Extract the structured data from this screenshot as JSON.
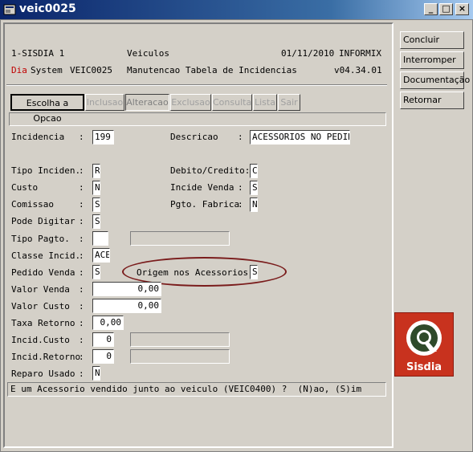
{
  "window": {
    "title": "veic0025",
    "minimize_glyph": "_",
    "maximize_glyph": "□",
    "close_glyph": "×"
  },
  "header": {
    "line1": {
      "system": "1-SISDIA 1",
      "module": "Veiculos",
      "date": "01/11/2010",
      "db": "INFORMIX"
    },
    "line2": {
      "prefix": "Dia",
      "system": "System",
      "program": "VEIC0025",
      "description": "Manutencao Tabela de Incidencias",
      "version": "v04.34.01"
    }
  },
  "menu": {
    "items": [
      {
        "label": "Escolha a Opcao",
        "state": "active"
      },
      {
        "label": "Inclusao",
        "state": "disabled"
      },
      {
        "label": "Alteracao",
        "state": "pressed"
      },
      {
        "label": "Exclusao",
        "state": "disabled"
      },
      {
        "label": "Consulta",
        "state": "disabled"
      },
      {
        "label": "Lista",
        "state": "disabled"
      },
      {
        "label": "Sair",
        "state": "disabled"
      }
    ]
  },
  "form": {
    "incidencia": {
      "label": "Incidencia",
      "value": "199"
    },
    "descricao": {
      "label": "Descricao",
      "value": "ACESSORIOS NO PEDIDO"
    },
    "tipo_inciden": {
      "label": "Tipo Inciden.",
      "value": "R"
    },
    "debito_credito": {
      "label": "Debito/Credito:",
      "value": "C"
    },
    "custo": {
      "label": "Custo",
      "value": "N"
    },
    "incide_venda": {
      "label": "Incide Venda",
      "value": "S"
    },
    "comissao": {
      "label": "Comissao",
      "value": "S"
    },
    "pgto_fabrica": {
      "label": "Pgto. Fabrica",
      "value": "N"
    },
    "pode_digitar": {
      "label": "Pode Digitar",
      "value": "S"
    },
    "tipo_pagto": {
      "label": "Tipo Pagto.",
      "value": "",
      "desc": ""
    },
    "classe_incid": {
      "label": "Classe Incid.",
      "value": "ACE"
    },
    "pedido_venda": {
      "label": "Pedido Venda",
      "value": "S"
    },
    "origem_acessorios": {
      "label": "Origem nos Acessorios:",
      "value": "S"
    },
    "valor_venda": {
      "label": "Valor Venda",
      "value": "0,00"
    },
    "valor_custo": {
      "label": "Valor Custo",
      "value": "0,00"
    },
    "taxa_retorno": {
      "label": "Taxa Retorno",
      "value": "0,00"
    },
    "incid_custo": {
      "label": "Incid.Custo",
      "value": "0",
      "desc": ""
    },
    "incid_retorno": {
      "label": "Incid.Retorno",
      "value": "0",
      "desc": ""
    },
    "reparo_usado": {
      "label": "Reparo Usado",
      "value": "N"
    },
    "colon": ":"
  },
  "message": "E um Acessorio vendido junto ao veiculo (VEIC0400) ?  (N)ao, (S)im",
  "sidebar": {
    "concluir": "Concluir",
    "interromper": "Interromper",
    "documentacao": "Documentação",
    "retornar": "Retornar"
  },
  "logo": {
    "text": "Sisdia"
  },
  "colors": {
    "title_bar": "#0a246a",
    "highlight_ellipse": "#7a1c1c",
    "logo_bg": "#c8321e",
    "dia_red": "#c00000"
  }
}
